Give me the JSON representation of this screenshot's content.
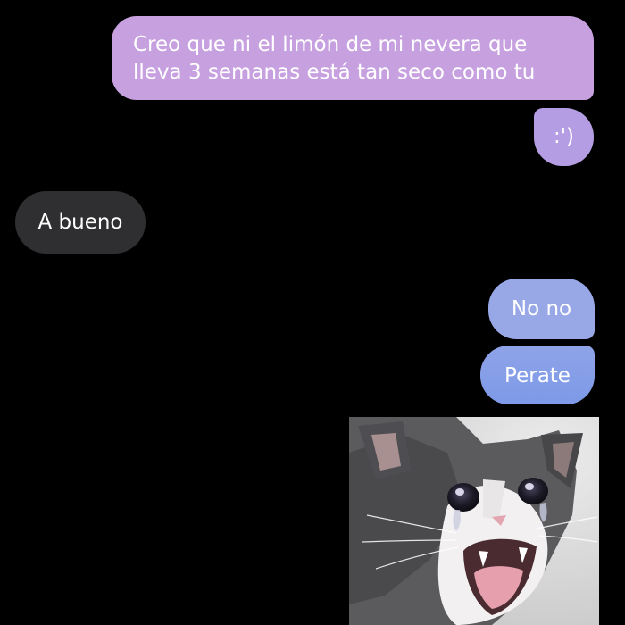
{
  "colors": {
    "background": "#000000",
    "sent_bubble_purple": "#c7a0e0",
    "sent_bubble_blue": "#98a8e6",
    "received_bubble": "#2f2f31",
    "text": "#ffffff"
  },
  "messages": [
    {
      "direction": "sent",
      "text": "Creo que ni el limón de mi nevera que\nlleva 3 semanas está tan seco como tu"
    },
    {
      "direction": "sent",
      "text": ":')"
    },
    {
      "direction": "received",
      "text": "A bueno"
    },
    {
      "direction": "sent",
      "text": "No no"
    },
    {
      "direction": "sent",
      "text": "Perate"
    }
  ],
  "attachment": {
    "type": "image",
    "subject": "crying-cat-meme"
  }
}
